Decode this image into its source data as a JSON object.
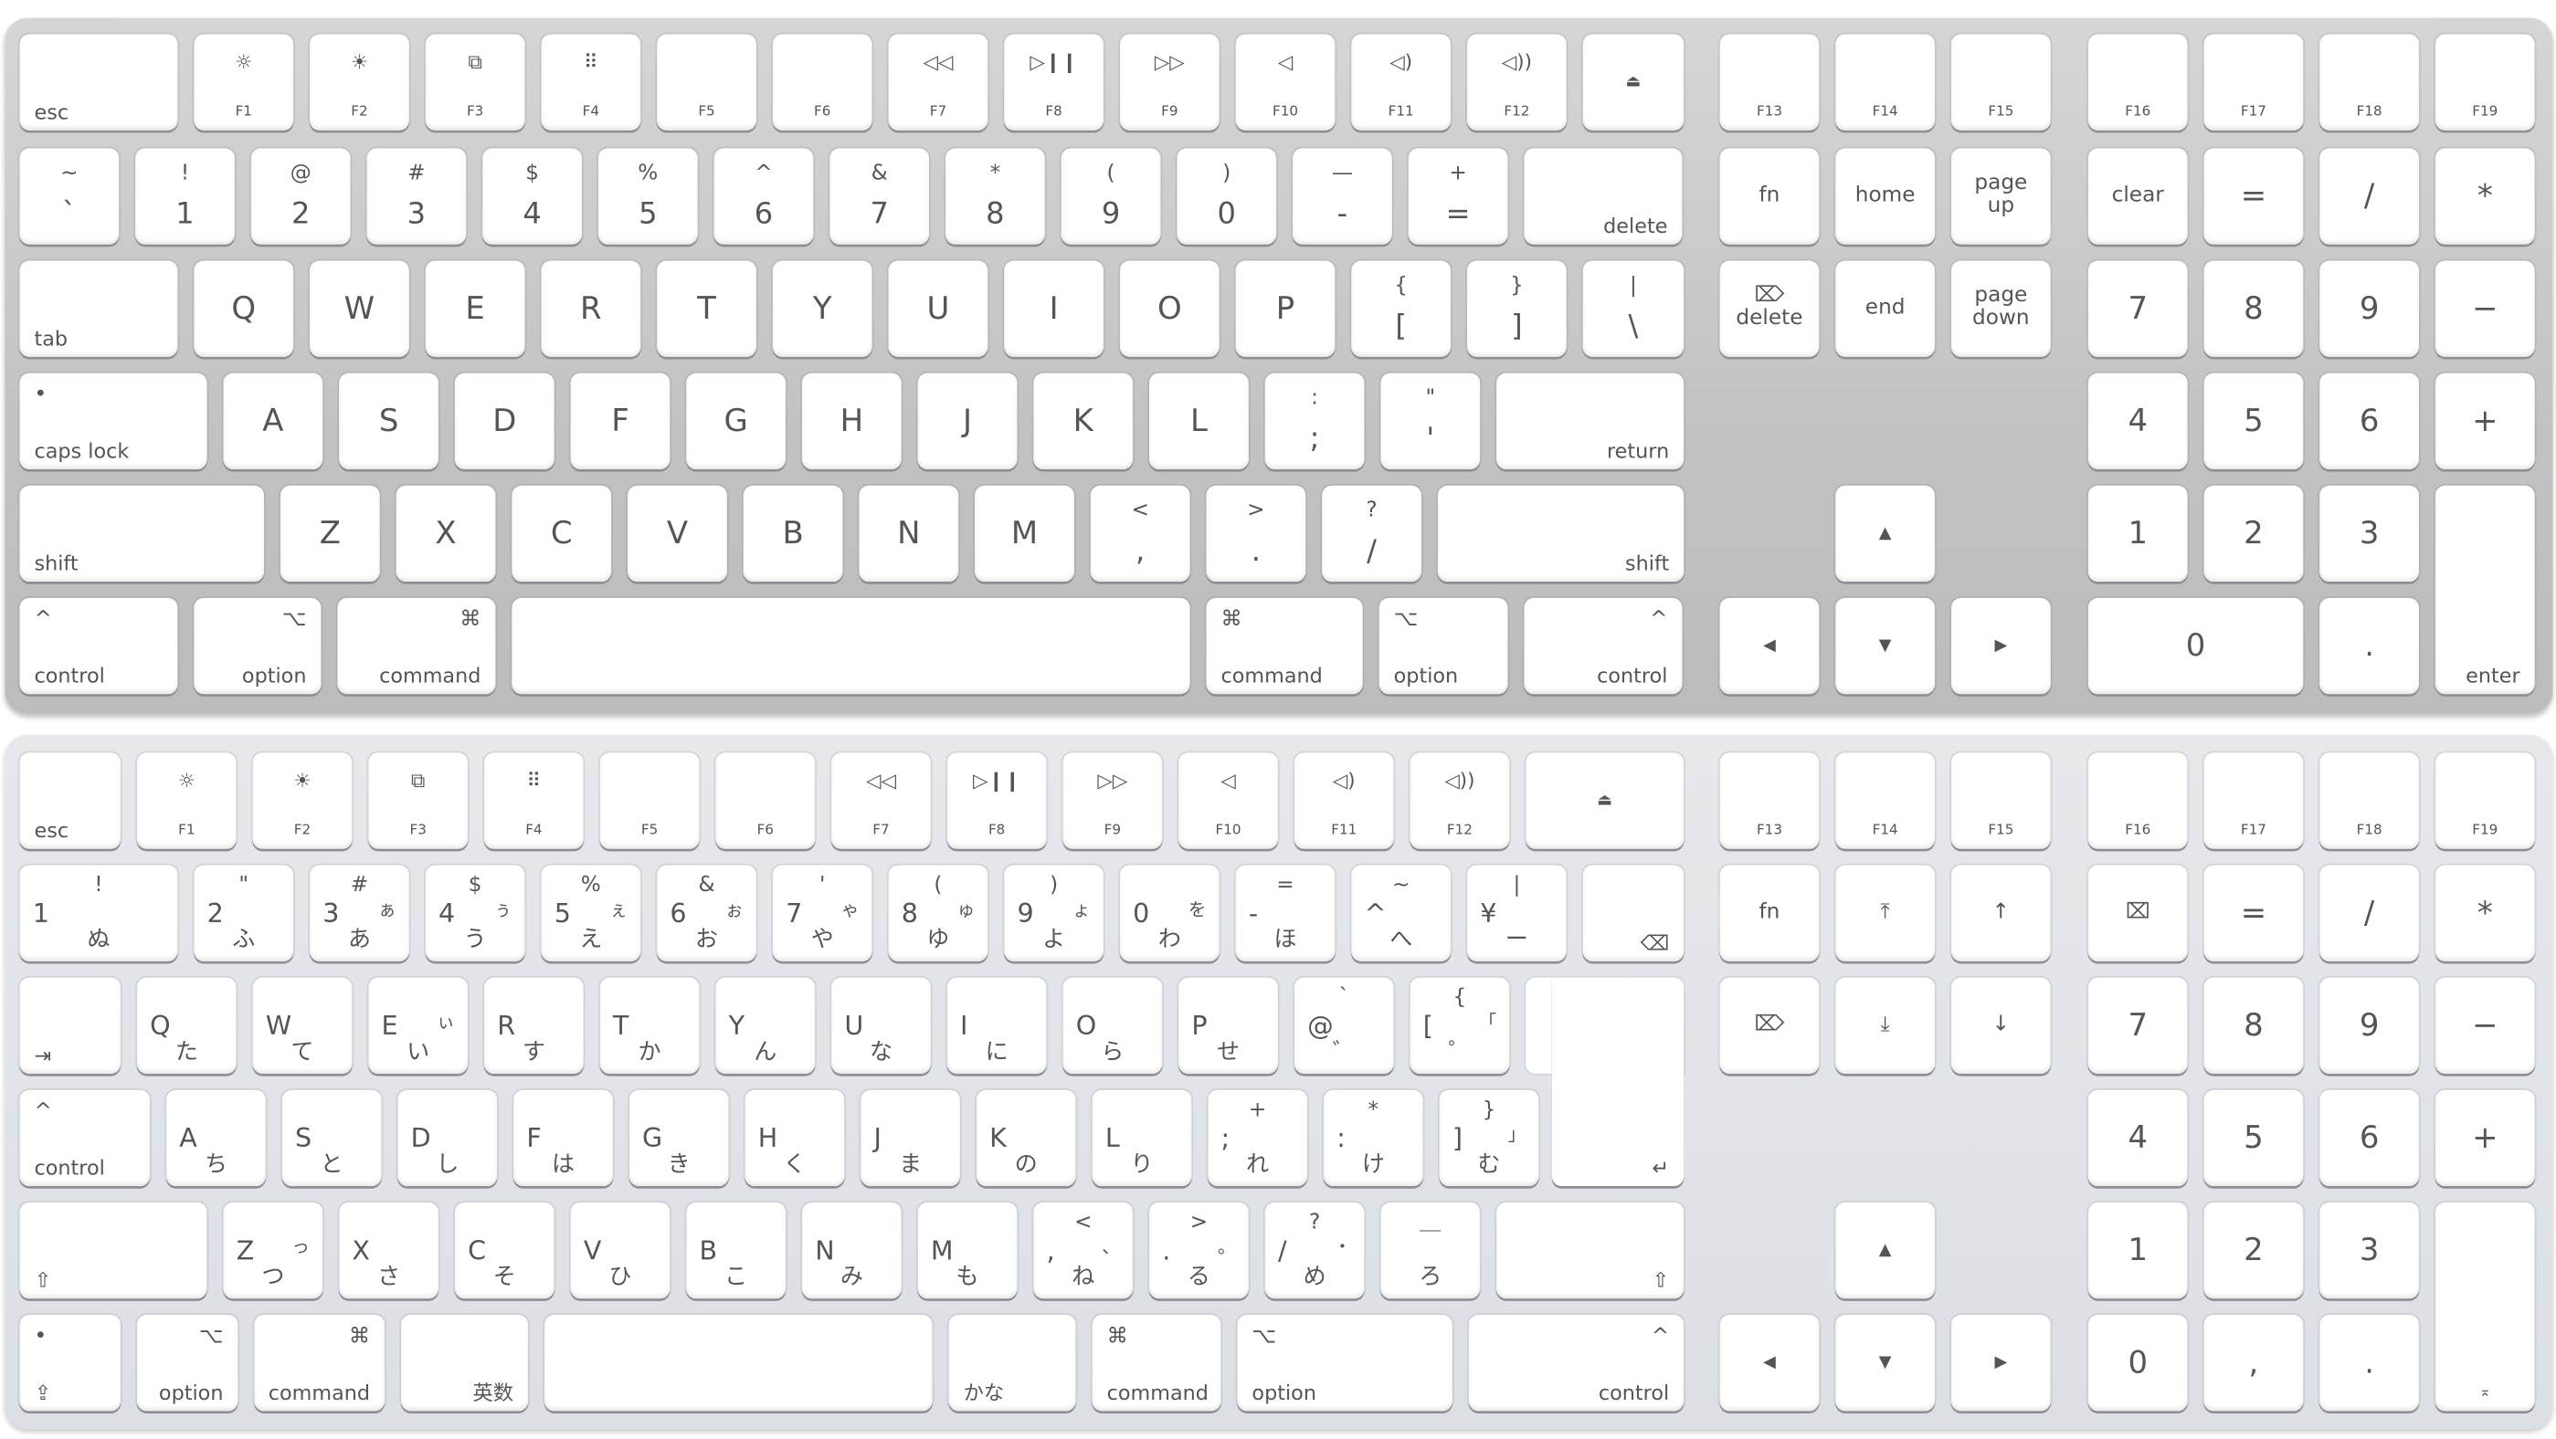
{
  "keyboards": [
    {
      "name": "us",
      "rows": [
        [
          {
            "bl": "esc"
          },
          {
            "t": "☼",
            "b": "F1"
          },
          {
            "t": "☀",
            "b": "F2"
          },
          {
            "t": "⧉",
            "b": "F3"
          },
          {
            "t": "⠿",
            "b": "F4"
          },
          {
            "b": "F5"
          },
          {
            "b": "F6"
          },
          {
            "t": "◁◁",
            "b": "F7"
          },
          {
            "t": "▷❙❙",
            "b": "F8"
          },
          {
            "t": "▷▷",
            "b": "F9"
          },
          {
            "t": "◁",
            "b": "F10"
          },
          {
            "t": "◁)",
            "b": "F11"
          },
          {
            "t": "◁))",
            "b": "F12"
          },
          {
            "ci": "⏏"
          }
        ],
        [
          {
            "up": "~",
            "lo": "`"
          },
          {
            "up": "!",
            "lo": "1"
          },
          {
            "up": "@",
            "lo": "2"
          },
          {
            "up": "#",
            "lo": "3"
          },
          {
            "up": "$",
            "lo": "4"
          },
          {
            "up": "%",
            "lo": "5"
          },
          {
            "up": "^",
            "lo": "6"
          },
          {
            "up": "&",
            "lo": "7"
          },
          {
            "up": "*",
            "lo": "8"
          },
          {
            "up": "(",
            "lo": "9"
          },
          {
            "up": ")",
            "lo": "0"
          },
          {
            "up": "—",
            "lo": "-"
          },
          {
            "up": "+",
            "lo": "="
          },
          {
            "br": "delete"
          }
        ],
        [
          {
            "bl": "tab"
          },
          {
            "c": "Q"
          },
          {
            "c": "W"
          },
          {
            "c": "E"
          },
          {
            "c": "R"
          },
          {
            "c": "T"
          },
          {
            "c": "Y"
          },
          {
            "c": "U"
          },
          {
            "c": "I"
          },
          {
            "c": "O"
          },
          {
            "c": "P"
          },
          {
            "up": "{",
            "lo": "["
          },
          {
            "up": "}",
            "lo": "]"
          },
          {
            "up": "|",
            "lo": "\\"
          }
        ],
        [
          {
            "tl": "•",
            "bl": "caps lock"
          },
          {
            "c": "A"
          },
          {
            "c": "S"
          },
          {
            "c": "D"
          },
          {
            "c": "F"
          },
          {
            "c": "G"
          },
          {
            "c": "H"
          },
          {
            "c": "J"
          },
          {
            "c": "K"
          },
          {
            "c": "L"
          },
          {
            "up": ":",
            "lo": ";"
          },
          {
            "up": "\"",
            "lo": "'"
          },
          {
            "br": "return"
          }
        ],
        [
          {
            "bl": "shift"
          },
          {
            "c": "Z"
          },
          {
            "c": "X"
          },
          {
            "c": "C"
          },
          {
            "c": "V"
          },
          {
            "c": "B"
          },
          {
            "c": "N"
          },
          {
            "c": "M"
          },
          {
            "up": "<",
            "lo": ","
          },
          {
            "up": ">",
            "lo": "."
          },
          {
            "up": "?",
            "lo": "/"
          },
          {
            "br": "shift"
          }
        ],
        [
          {
            "tl": "^",
            "bl": "control"
          },
          {
            "tr": "⌥",
            "br": "option"
          },
          {
            "tr": "⌘",
            "br": "command"
          },
          {},
          {
            "tl": "⌘",
            "bl": "command"
          },
          {
            "tl": "⌥",
            "bl": "option"
          },
          {
            "tr": "^",
            "br": "control"
          }
        ]
      ],
      "nav": [
        {
          "b": "F13"
        },
        {
          "b": "F14"
        },
        {
          "b": "F15"
        },
        {
          "m": "fn"
        },
        {
          "m": "home"
        },
        {
          "m": "page\nup"
        },
        {
          "m": "⌦\ndelete"
        },
        {
          "m": "end"
        },
        {
          "m": "page\ndown"
        },
        {
          "ci": "▲"
        },
        {
          "ci": "◀"
        },
        {
          "ci": "▼"
        },
        {
          "ci": "▶"
        }
      ],
      "numpad": [
        {
          "b": "F16"
        },
        {
          "b": "F17"
        },
        {
          "b": "F18"
        },
        {
          "b": "F19"
        },
        {
          "m": "clear"
        },
        {
          "c": "="
        },
        {
          "c": "/"
        },
        {
          "c": "*"
        },
        {
          "c": "7"
        },
        {
          "c": "8"
        },
        {
          "c": "9"
        },
        {
          "c": "−"
        },
        {
          "c": "4"
        },
        {
          "c": "5"
        },
        {
          "c": "6"
        },
        {
          "c": "+"
        },
        {
          "c": "1"
        },
        {
          "c": "2"
        },
        {
          "c": "3"
        },
        {
          "br": "enter"
        },
        {
          "c": "0"
        },
        {
          "c": "."
        }
      ]
    },
    {
      "name": "jp",
      "rows": [
        [
          {
            "bl": "esc"
          },
          {
            "t": "☼",
            "b": "F1"
          },
          {
            "t": "☀",
            "b": "F2"
          },
          {
            "t": "⧉",
            "b": "F3"
          },
          {
            "t": "⠿",
            "b": "F4"
          },
          {
            "b": "F5"
          },
          {
            "b": "F6"
          },
          {
            "t": "◁◁",
            "b": "F7"
          },
          {
            "t": "▷❙❙",
            "b": "F8"
          },
          {
            "t": "▷▷",
            "b": "F9"
          },
          {
            "t": "◁",
            "b": "F10"
          },
          {
            "t": "◁)",
            "b": "F11"
          },
          {
            "t": "◁))",
            "b": "F12"
          },
          {
            "ci": "⏏"
          }
        ],
        [
          {
            "sym": "!",
            "L": "1",
            "k": "ぬ"
          },
          {
            "sym": "\"",
            "L": "2",
            "k": "ふ"
          },
          {
            "sym": "#",
            "L": "3",
            "kr": "ぁ",
            "k": "あ"
          },
          {
            "sym": "$",
            "L": "4",
            "kr": "ぅ",
            "k": "う"
          },
          {
            "sym": "%",
            "L": "5",
            "kr": "ぇ",
            "k": "え"
          },
          {
            "sym": "&",
            "L": "6",
            "kr": "ぉ",
            "k": "お"
          },
          {
            "sym": "'",
            "L": "7",
            "kr": "ゃ",
            "k": "や"
          },
          {
            "sym": "(",
            "L": "8",
            "kr": "ゅ",
            "k": "ゆ"
          },
          {
            "sym": ")",
            "L": "9",
            "kr": "ょ",
            "k": "よ"
          },
          {
            "L": "0",
            "kr": "を",
            "k": "わ"
          },
          {
            "sym": "=",
            "L": "-",
            "k": "ほ"
          },
          {
            "sym": "~",
            "L": "^",
            "k": "へ"
          },
          {
            "sym": "|",
            "L": "¥",
            "k": "ー"
          },
          {
            "br": "⌫"
          }
        ],
        [
          {
            "bl": "⇥"
          },
          {
            "L": "Q",
            "k": "た"
          },
          {
            "L": "W",
            "k": "て"
          },
          {
            "L": "E",
            "kr": "ぃ",
            "k": "い"
          },
          {
            "L": "R",
            "k": "す"
          },
          {
            "L": "T",
            "k": "か"
          },
          {
            "L": "Y",
            "k": "ん"
          },
          {
            "L": "U",
            "k": "な"
          },
          {
            "L": "I",
            "k": "に"
          },
          {
            "L": "O",
            "k": "ら"
          },
          {
            "L": "P",
            "k": "せ"
          },
          {
            "sym": "`",
            "L": "@",
            "k": "゛"
          },
          {
            "sym": "{",
            "L": "[",
            "kr": "「",
            "k": "゜"
          }
        ],
        [
          {
            "tl": "^",
            "bl": "control"
          },
          {
            "L": "A",
            "k": "ち"
          },
          {
            "L": "S",
            "k": "と"
          },
          {
            "L": "D",
            "k": "し"
          },
          {
            "L": "F",
            "k": "は"
          },
          {
            "L": "G",
            "k": "き"
          },
          {
            "L": "H",
            "k": "く"
          },
          {
            "L": "J",
            "k": "ま"
          },
          {
            "L": "K",
            "k": "の"
          },
          {
            "L": "L",
            "k": "り"
          },
          {
            "sym": "+",
            "L": ";",
            "k": "れ"
          },
          {
            "sym": "*",
            "L": ":",
            "k": "け"
          },
          {
            "sym": "}",
            "L": "]",
            "kr": "」",
            "k": "む"
          }
        ],
        [
          {
            "bl": "⇧"
          },
          {
            "L": "Z",
            "kr": "っ",
            "k": "つ"
          },
          {
            "L": "X",
            "k": "さ"
          },
          {
            "L": "C",
            "k": "そ"
          },
          {
            "L": "V",
            "k": "ひ"
          },
          {
            "L": "B",
            "k": "こ"
          },
          {
            "L": "N",
            "k": "み"
          },
          {
            "L": "M",
            "k": "も"
          },
          {
            "sym": "<",
            "L": ",",
            "kr": "、",
            "k": "ね"
          },
          {
            "sym": ">",
            "L": ".",
            "kr": "。",
            "k": "る"
          },
          {
            "sym": "?",
            "L": "/",
            "kr": "・",
            "k": "め"
          },
          {
            "sym": "＿",
            "k": "ろ"
          },
          {
            "br": "⇧"
          }
        ],
        [
          {
            "tl": "•",
            "bl": "⇪"
          },
          {
            "tr": "⌥",
            "br": "option"
          },
          {
            "tr": "⌘",
            "br": "command"
          },
          {
            "br": "英数"
          },
          {},
          {
            "bl": "かな"
          },
          {
            "tl": "⌘",
            "bl": "command"
          },
          {
            "tl": "⌥",
            "bl": "option"
          },
          {
            "tr": "^",
            "br": "control"
          }
        ]
      ],
      "return_key": {
        "br": "↵"
      },
      "nav": [
        {
          "b": "F13"
        },
        {
          "b": "F14"
        },
        {
          "b": "F15"
        },
        {
          "m": "fn"
        },
        {
          "m": "⤒"
        },
        {
          "m": "↑"
        },
        {
          "m": "⌦"
        },
        {
          "m": "⤓"
        },
        {
          "m": "↓"
        },
        {
          "ci": "▲"
        },
        {
          "ci": "◀"
        },
        {
          "ci": "▼"
        },
        {
          "ci": "▶"
        }
      ],
      "numpad": [
        {
          "b": "F16"
        },
        {
          "b": "F17"
        },
        {
          "b": "F18"
        },
        {
          "b": "F19"
        },
        {
          "m": "⌧"
        },
        {
          "c": "="
        },
        {
          "c": "/"
        },
        {
          "c": "*"
        },
        {
          "c": "7"
        },
        {
          "c": "8"
        },
        {
          "c": "9"
        },
        {
          "c": "−"
        },
        {
          "c": "4"
        },
        {
          "c": "5"
        },
        {
          "c": "6"
        },
        {
          "c": "+"
        },
        {
          "c": "1"
        },
        {
          "c": "2"
        },
        {
          "c": "3"
        },
        {
          "b": "⌅"
        },
        {
          "c": "0"
        },
        {
          "c": ","
        },
        {
          "c": "."
        }
      ]
    }
  ]
}
